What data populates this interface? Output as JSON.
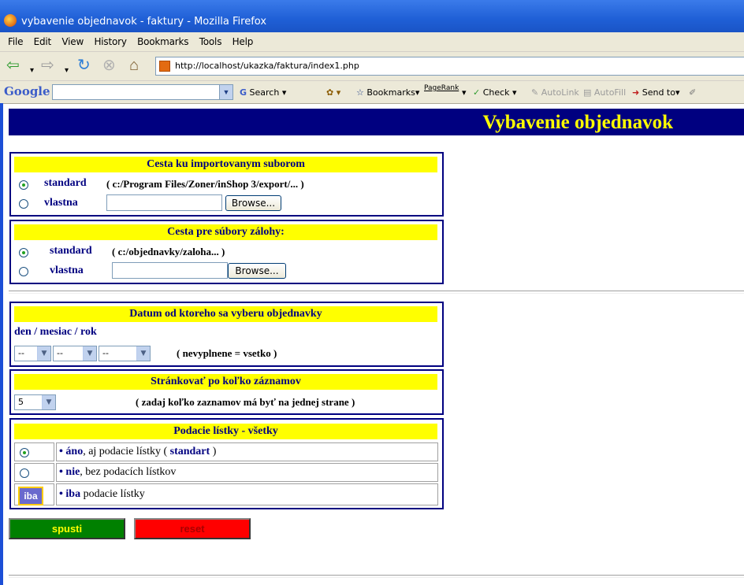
{
  "window": {
    "title": "vybavenie objednavok - faktury - Mozilla Firefox"
  },
  "menu": [
    "File",
    "Edit",
    "View",
    "History",
    "Bookmarks",
    "Tools",
    "Help"
  ],
  "nav": {
    "url": "http://localhost/ukazka/faktura/index1.php"
  },
  "google_toolbar": {
    "logo": "Google",
    "search_label": "Search",
    "bookmarks_label": "Bookmarks",
    "pagerank_label": "PageRank",
    "check_label": "Check",
    "autolink_label": "AutoLink",
    "autofill_label": "AutoFill",
    "sendto_label": "Send to"
  },
  "page": {
    "header_title": "Vybavenie objednavok",
    "import_path": {
      "heading": "Cesta ku importovanym suborom",
      "standard_label": "standard",
      "standard_value": "( c:/Program Files/Zoner/inShop 3/export/... )",
      "own_label": "vlastna",
      "browse_label": "Browse...",
      "selected": "standard"
    },
    "backup_path": {
      "heading": "Cesta pre súbory zálohy:",
      "standard_label": "standard",
      "standard_value": "( c:/objednavky/zaloha... )",
      "own_label": "vlastna",
      "browse_label": "Browse...",
      "selected": "standard"
    },
    "date_filter": {
      "heading": "Datum od ktoreho sa vyberu objednavky",
      "date_format_label": "den / mesiac / rok",
      "day": "--",
      "month": "--",
      "year": "--",
      "hint": "( nevyplnene = vsetko )"
    },
    "paging": {
      "heading": "Stránkovať po koľko záznamov",
      "value": "5",
      "hint": "( zadaj koľko zaznamov má byť na jednej strane )"
    },
    "delivery_notes": {
      "heading": "Podacie lístky - všetky",
      "options": [
        {
          "keyword": "áno",
          "text_a": ", aj podacie lístky ( ",
          "emph": "standart",
          "text_b": " )"
        },
        {
          "keyword": "nie",
          "text_a": ", bez podacích lístkov",
          "emph": "",
          "text_b": ""
        },
        {
          "keyword": "iba",
          "text_a": " podacie lístky",
          "emph": "",
          "text_b": ""
        }
      ],
      "bullet": "•",
      "iba_button": "iba",
      "selected_index": 0
    },
    "actions": {
      "run_label": "spusti",
      "reset_label": "reset",
      "run_color": "#008000",
      "reset_color": "#ff0000",
      "run_text_color": "#ffff00",
      "reset_text_color": "#aa0000"
    }
  },
  "colors": {
    "banner_bg": "#000080",
    "banner_text": "#ffff00",
    "panel_heading_bg": "#ffff00",
    "accent_blue": "#000080"
  }
}
